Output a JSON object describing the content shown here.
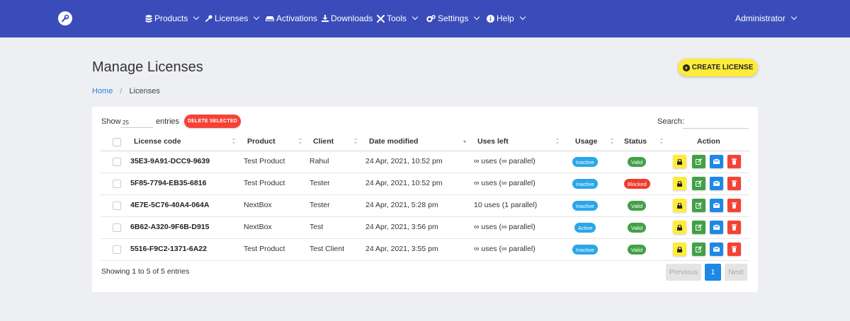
{
  "nav": {
    "items": [
      {
        "label": "Products",
        "icon": "database-icon",
        "dropdown": true
      },
      {
        "label": "Licenses",
        "icon": "key-icon",
        "dropdown": true
      },
      {
        "label": "Activations",
        "icon": "hdd-icon",
        "dropdown": false
      },
      {
        "label": "Downloads",
        "icon": "download-icon",
        "dropdown": false
      },
      {
        "label": "Tools",
        "icon": "tools-icon",
        "dropdown": true
      },
      {
        "label": "Settings",
        "icon": "cogs-icon",
        "dropdown": true
      },
      {
        "label": "Help",
        "icon": "info-circle-icon",
        "dropdown": true
      }
    ],
    "user": "Administrator"
  },
  "page": {
    "title": "Manage Licenses",
    "create_label": "CREATE LICENSE",
    "breadcrumb": {
      "home": "Home",
      "separator": "/",
      "current": "Licenses"
    }
  },
  "table_controls": {
    "show_label": "Show",
    "length_value": "25",
    "entries_label": "entries",
    "delete_selected_label": "DELETE SELECTED",
    "search_label": "Search:",
    "search_value": ""
  },
  "table": {
    "headers": {
      "license_code": "License code",
      "product": "Product",
      "client": "Client",
      "date_modified": "Date modified",
      "uses_left": "Uses left",
      "usage": "Usage",
      "status": "Status",
      "action": "Action"
    },
    "sorted_column": "date_modified",
    "sort_direction": "desc",
    "rows": [
      {
        "code": "35E3-9A91-DCC9-9639",
        "product": "Test Product",
        "client": "Rahul",
        "date": "24 Apr, 2021, 10:52 pm",
        "uses": "∞ uses (∞ parallel)",
        "usage": "Inactive",
        "status": "Valid"
      },
      {
        "code": "5F85-7794-EB35-6816",
        "product": "Test Product",
        "client": "Tester",
        "date": "24 Apr, 2021, 10:52 pm",
        "uses": "∞ uses (∞ parallel)",
        "usage": "Inactive",
        "status": "Blocked"
      },
      {
        "code": "4E7E-5C76-40A4-064A",
        "product": "NextBox",
        "client": "Tester",
        "date": "24 Apr, 2021, 5:28 pm",
        "uses": "10 uses (1 parallel)",
        "usage": "Inactive",
        "status": "Valid"
      },
      {
        "code": "6B62-A320-9F6B-D915",
        "product": "NextBox",
        "client": "Test",
        "date": "24 Apr, 2021, 3:56 pm",
        "uses": "∞ uses (∞ parallel)",
        "usage": "Active",
        "status": "Valid"
      },
      {
        "code": "5516-F9C2-1371-6A22",
        "product": "Test Product",
        "client": "Test Client",
        "date": "24 Apr, 2021, 3:55 pm",
        "uses": "∞ uses (∞ parallel)",
        "usage": "Inactive",
        "status": "Valid"
      }
    ]
  },
  "footer": {
    "info": "Showing 1 to 5 of 5 entries",
    "previous_label": "Previous",
    "current_page": "1",
    "next_label": "Next"
  },
  "colors": {
    "navbar": "#3a4cb9",
    "accent_yellow": "#ffeb3b",
    "danger": "#f44336",
    "success": "#43a047",
    "info": "#2aa7e8",
    "primary": "#1e88e5"
  }
}
